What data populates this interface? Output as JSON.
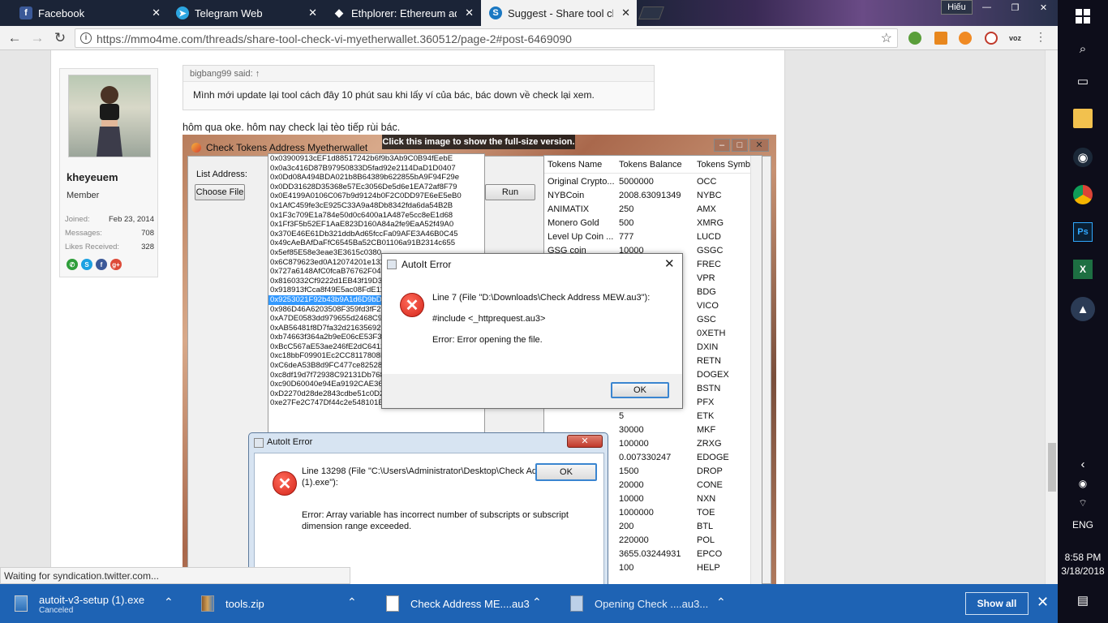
{
  "browser": {
    "tabs": [
      {
        "title": "Facebook",
        "icon": "facebook-icon",
        "color": "#3b5998",
        "glyph": "f"
      },
      {
        "title": "Telegram Web",
        "icon": "telegram-icon",
        "color": "#2ca5e0",
        "glyph": "➤"
      },
      {
        "title": "Ethplorer: Ethereum addr",
        "icon": "ethplorer-icon",
        "color": "#222222",
        "glyph": "◆"
      },
      {
        "title": "Suggest - Share tool che",
        "icon": "suggest-icon",
        "color": "#1a78c2",
        "glyph": "S"
      }
    ],
    "window_user": "Hiếu",
    "window_controls": {
      "min": "—",
      "max": "❐",
      "close": "✕"
    },
    "url": "https://mmo4me.com/threads/share-tool-check-vi-myetherwallet.360512/page-2#post-6469090"
  },
  "post": {
    "quote_author": "bigbang99 said: ↑",
    "quote_text": "Mình mới update lại tool cách đây 10 phút sau khi lấy ví của bác, bác down về check lại xem.",
    "reply_text": "hôm qua oke. hôm nay check lại tèo tiếp rùi bác."
  },
  "user": {
    "name": "kheyeuem",
    "role": "Member",
    "stats": [
      {
        "label": "Joined:",
        "value": "Feb 23, 2014"
      },
      {
        "label": "Messages:",
        "value": "708"
      },
      {
        "label": "Likes Received:",
        "value": "328"
      }
    ]
  },
  "screenshot": {
    "tooltip": "Click this image to show the full-size version.",
    "app_title": "Check Tokens Address Myetherwallet",
    "list_label": "List Address:",
    "choose_btn": "Choose File",
    "run_btn": "Run",
    "addresses": [
      "0x03900913cEF1d88517242b6f9b3Ab9C0B94fEebE",
      "0x0a3c416D87B97950833D5fad92e2114DaD1D0407",
      "0x0Dd08A494BDA021b8B64389b622855bA9F94F29e",
      "0x0DD31628D35368e57Ec3056De5d6e1EA72af8F79",
      "0x0E4199A0106C067b9d9124b0F2C0DD97E6eE5eB0",
      "0x1AfC459fe3cE925C33A9a48Db8342fda6da54B2B",
      "0x1F3c709E1a784e50d0c6400a1A487e5cc8eE1d68",
      "0x1Ff3F5b52EF1AaE823D160A84a2fe9EaA52f49A0",
      "0x370E46E61Db321ddbAd65fccFa09AFE3A46B0C45",
      "0x49cAeBAfDaFfC6545Ba52CB01106a91B2314c655",
      "0x5ef85E58e3eae3E3615c0380",
      "0x6C879623ed0A12074201e132",
      "0x727a6148AfC0fcaB76762F049",
      "0x8160332Cf9222d1EB43f19D30",
      "0x918913fCca8f49E5ac08FdE11",
      "0x9253021F92b43b9A1d6D9bD3",
      "0x986D46A6203508F359fd3fF27",
      "0xA7DE0583dd979655d2468C9d",
      "0xAB56481f8D7fa32d21635692d",
      "0xb74663f364a2b9eE06cE53F35",
      "0xBcC567aE53ae246fE2dC6412",
      "0xc18bbF09901Ec2CC8117808F",
      "0xC6deA53B8d9FC477ce825281",
      "0xc8df19d7f72938C92131Db768",
      "0xc90D60040e94Ea9192CAE36c",
      "0xD2270d28de2843cdbe51c0D2",
      "0xe27Fe2C747Df44c2e548101B"
    ],
    "selected_index": 15,
    "token_headers": [
      "Tokens Name",
      "Tokens Balance",
      "Tokens Symb"
    ],
    "tokens": [
      {
        "name": "Original Crypto...",
        "balance": "5000000",
        "symbol": "OCC"
      },
      {
        "name": "NYBCoin",
        "balance": "2008.63091349",
        "symbol": "NYBC"
      },
      {
        "name": "ANIMATIX",
        "balance": "250",
        "symbol": "AMX"
      },
      {
        "name": "Monero Gold",
        "balance": "500",
        "symbol": "XMRG"
      },
      {
        "name": "Level Up Coin ...",
        "balance": "777",
        "symbol": "LUCD"
      },
      {
        "name": "GSG coin",
        "balance": "10000",
        "symbol": "GSGC"
      },
      {
        "name": "",
        "balance": "",
        "symbol": "FREC"
      },
      {
        "name": "",
        "balance": "",
        "symbol": "VPR"
      },
      {
        "name": "",
        "balance": "",
        "symbol": "BDG"
      },
      {
        "name": "",
        "balance": "",
        "symbol": "VICO"
      },
      {
        "name": "",
        "balance": "",
        "symbol": "GSC"
      },
      {
        "name": "",
        "balance": "",
        "symbol": "0XETH"
      },
      {
        "name": "",
        "balance": "",
        "symbol": "DXIN"
      },
      {
        "name": "",
        "balance": "",
        "symbol": "RETN"
      },
      {
        "name": "",
        "balance": "",
        "symbol": "DOGEX"
      },
      {
        "name": "",
        "balance": "",
        "symbol": "BSTN"
      },
      {
        "name": "",
        "balance": "",
        "symbol": "PFX"
      },
      {
        "name": "",
        "balance": "5",
        "symbol": "ETK"
      },
      {
        "name": "",
        "balance": "30000",
        "symbol": "MKF"
      },
      {
        "name": "",
        "balance": "100000",
        "symbol": "ZRXG"
      },
      {
        "name": "",
        "balance": "0.007330247",
        "symbol": "EDOGE"
      },
      {
        "name": "",
        "balance": "1500",
        "symbol": "DROP"
      },
      {
        "name": "",
        "balance": "20000",
        "symbol": "CONE"
      },
      {
        "name": "",
        "balance": "10000",
        "symbol": "NXN"
      },
      {
        "name": "",
        "balance": "1000000",
        "symbol": "TOE"
      },
      {
        "name": "",
        "balance": "200",
        "symbol": "BTL"
      },
      {
        "name": "",
        "balance": "220000",
        "symbol": "POL"
      },
      {
        "name": "",
        "balance": "3655.03244931",
        "symbol": "EPCO"
      },
      {
        "name": "",
        "balance": "100",
        "symbol": "HELP"
      }
    ],
    "dialog1": {
      "title": "AutoIt Error",
      "line1": "Line 7  (File \"D:\\Downloads\\Check Address MEW.au3\"):",
      "line2": "#include <_httprequest.au3>",
      "line3": "Error: Error opening the file.",
      "ok": "OK"
    },
    "dialog2": {
      "title": "AutoIt Error",
      "line1": "Line 13298  (File \"C:\\Users\\Administrator\\Desktop\\Check Address MEW",
      "line1b": "(1).exe\"):",
      "line2": "Error: Array variable has incorrect number of subscripts or subscript",
      "line2b": "dimension range exceeded.",
      "ok": "OK"
    }
  },
  "status_text": "Waiting for syndication.twitter.com...",
  "downloads": [
    {
      "name": "autoit-v3-setup (1).exe",
      "sub": "Canceled"
    },
    {
      "name": "tools.zip",
      "sub": ""
    },
    {
      "name": "Check Address ME....au3",
      "sub": ""
    },
    {
      "name": "Opening Check ....au3...",
      "sub": ""
    }
  ],
  "show_all": "Show all",
  "system": {
    "time": "8:58 PM",
    "date": "3/18/2018",
    "lang": "ENG"
  },
  "colors": {
    "download_bar": "#1e63b4",
    "tab_bar": "#1b2437",
    "selection": "#3399ff"
  }
}
